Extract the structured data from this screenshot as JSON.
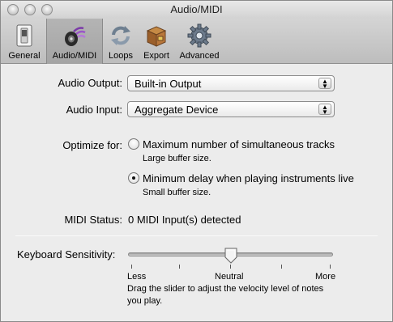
{
  "window": {
    "title": "Audio/MIDI"
  },
  "toolbar": {
    "items": [
      {
        "label": "General",
        "icon": "switch-icon"
      },
      {
        "label": "Audio/MIDI",
        "icon": "audio-speaker-icon",
        "selected": true
      },
      {
        "label": "Loops",
        "icon": "loops-icon"
      },
      {
        "label": "Export",
        "icon": "export-box-icon"
      },
      {
        "label": "Advanced",
        "icon": "gear-icon"
      }
    ]
  },
  "audio": {
    "output_label": "Audio Output:",
    "output_value": "Built-in Output",
    "input_label": "Audio Input:",
    "input_value": "Aggregate Device"
  },
  "optimize": {
    "label": "Optimize for:",
    "options": [
      {
        "text": "Maximum number of simultaneous tracks",
        "sub": "Large buffer size.",
        "selected": false
      },
      {
        "text": "Minimum delay when playing instruments live",
        "sub": "Small buffer size.",
        "selected": true
      }
    ]
  },
  "midi": {
    "label": "MIDI Status:",
    "value": "0 MIDI Input(s) detected"
  },
  "keyboard": {
    "label": "Keyboard Sensitivity:",
    "min_label": "Less",
    "mid_label": "Neutral",
    "max_label": "More",
    "value_fraction": 0.5,
    "help_line1": "Drag the slider to adjust the velocity level of notes",
    "help_line2": "you play."
  }
}
